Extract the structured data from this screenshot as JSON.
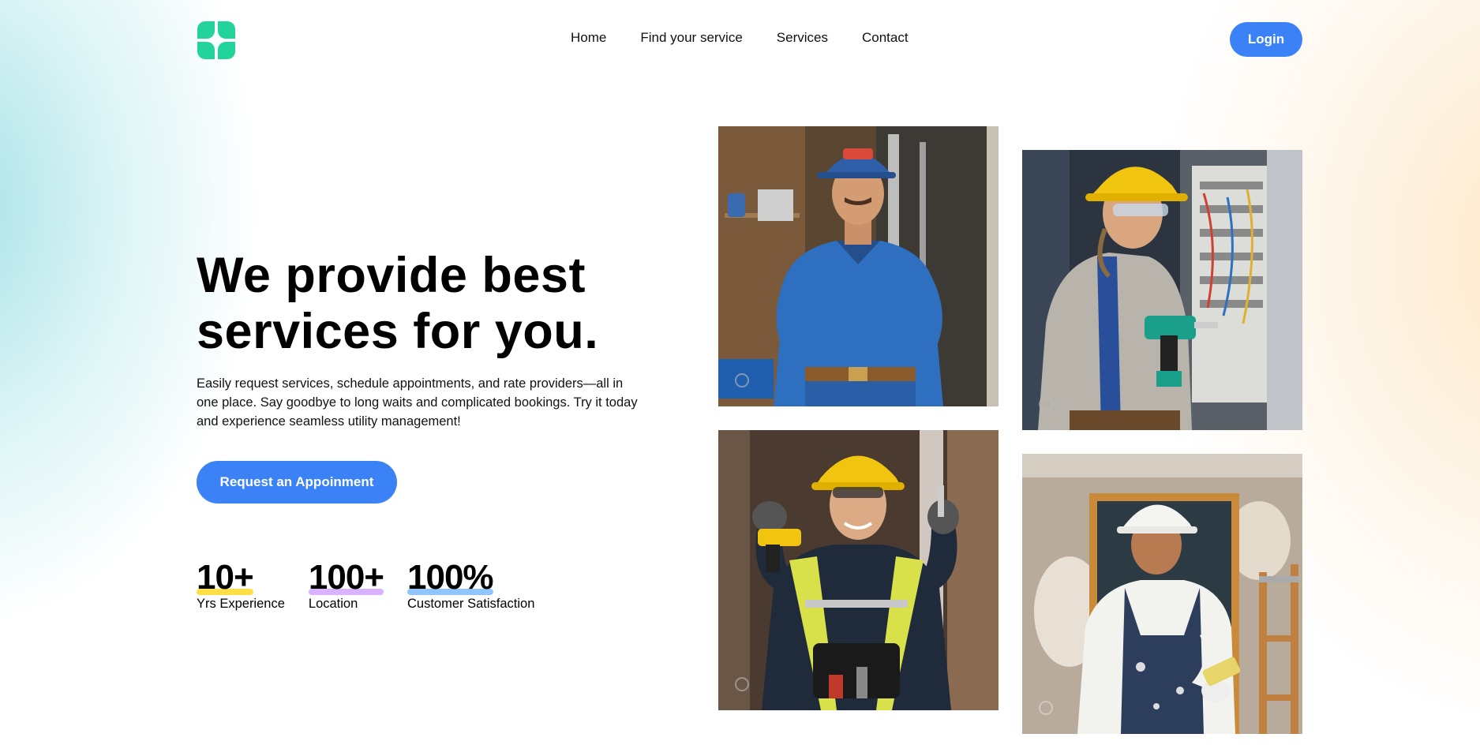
{
  "nav": {
    "logo_icon": "clover-logo-icon",
    "links": [
      "Home",
      "Find your service",
      "Services",
      "Contact"
    ],
    "login_label": "Login"
  },
  "hero": {
    "title_line1": "We provide best",
    "title_line2": "services for you.",
    "description": "Easily request services, schedule appointments, and rate providers—all in one place. Say goodbye to long waits and complicated bookings. Try it today and experience seamless utility management!",
    "cta_label": "Request an Appoinment"
  },
  "stats": [
    {
      "value": "10+",
      "label": "Yrs Experience",
      "color": "#fde047"
    },
    {
      "value": "100+",
      "label": "Location",
      "color": "#d8b4fe"
    },
    {
      "value": "100%",
      "label": "Customer Satisfaction",
      "color": "#93c5fd"
    }
  ],
  "colors": {
    "accent": "#3b82f6",
    "logo": "#22d39a"
  },
  "images": [
    {
      "name": "plumber-photo",
      "description_icon": "worker-photo"
    },
    {
      "name": "electrician-photo",
      "description_icon": "worker-photo"
    },
    {
      "name": "construction-worker-photo",
      "description_icon": "worker-photo"
    },
    {
      "name": "painter-photo",
      "description_icon": "worker-photo"
    }
  ]
}
